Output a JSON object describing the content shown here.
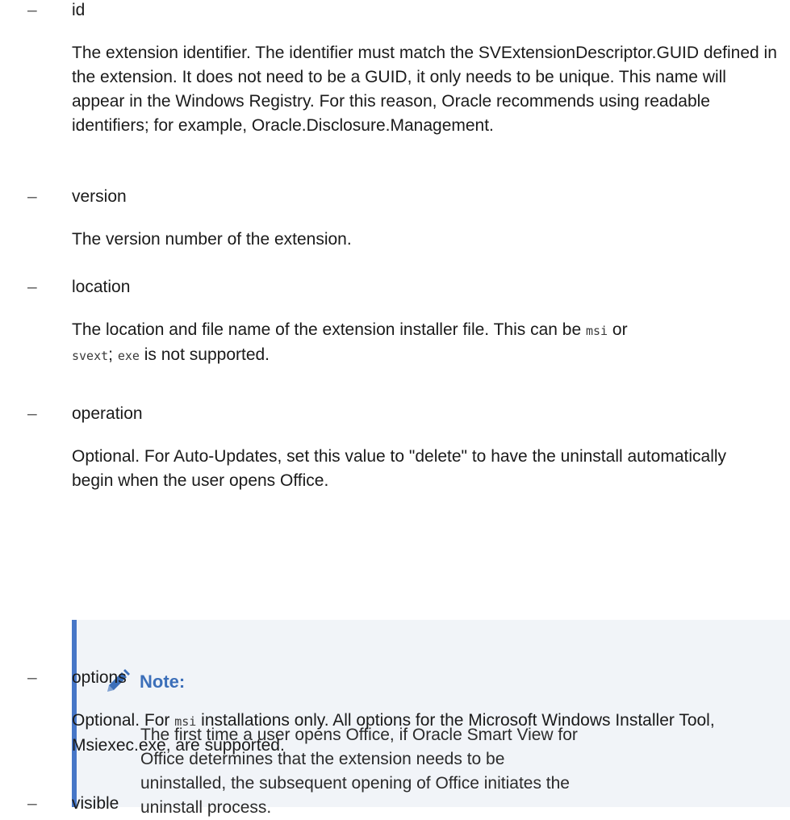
{
  "items": [
    {
      "dash": "–",
      "term": "id",
      "description": "The extension identifier. The identifier must match the SVExtensionDescriptor.GUID defined in the extension. It does not need to be a GUID, it only needs to be unique. This name will appear in the Windows Registry. For this reason, Oracle recommends using readable identifiers; for example, Oracle.Disclosure.Management."
    },
    {
      "dash": "–",
      "term": "version",
      "description": "The version number of the extension."
    },
    {
      "dash": "–",
      "term": "location",
      "description_part1": "The location and file name of the extension installer file. This can be ",
      "code1": "msi",
      "description_part2": " or ",
      "code2": "svext",
      "description_part3": "; ",
      "code3": "exe",
      "description_part4": " is not supported."
    },
    {
      "dash": "–",
      "term": "operation",
      "description": "Optional. For Auto-Updates, set this value to \"delete\" to have the uninstall automatically begin when the user opens Office."
    },
    {
      "dash": "–",
      "term": "options",
      "description_part1": "Optional. For ",
      "code1": "msi",
      "description_part2": " installations only. All options for the Microsoft Windows Installer Tool, Msiexec.exe, are supported."
    },
    {
      "dash": "–",
      "term": "visible"
    }
  ],
  "note": {
    "icon": "pencil-icon",
    "title": "Note:",
    "body": "The first time a user opens Office, if Oracle Smart View for Office determines that the extension needs to be uninstalled, the subsequent opening of Office initiates the uninstall process.",
    "accent_color": "#4676c7",
    "background_color": "#f1f4f8"
  }
}
